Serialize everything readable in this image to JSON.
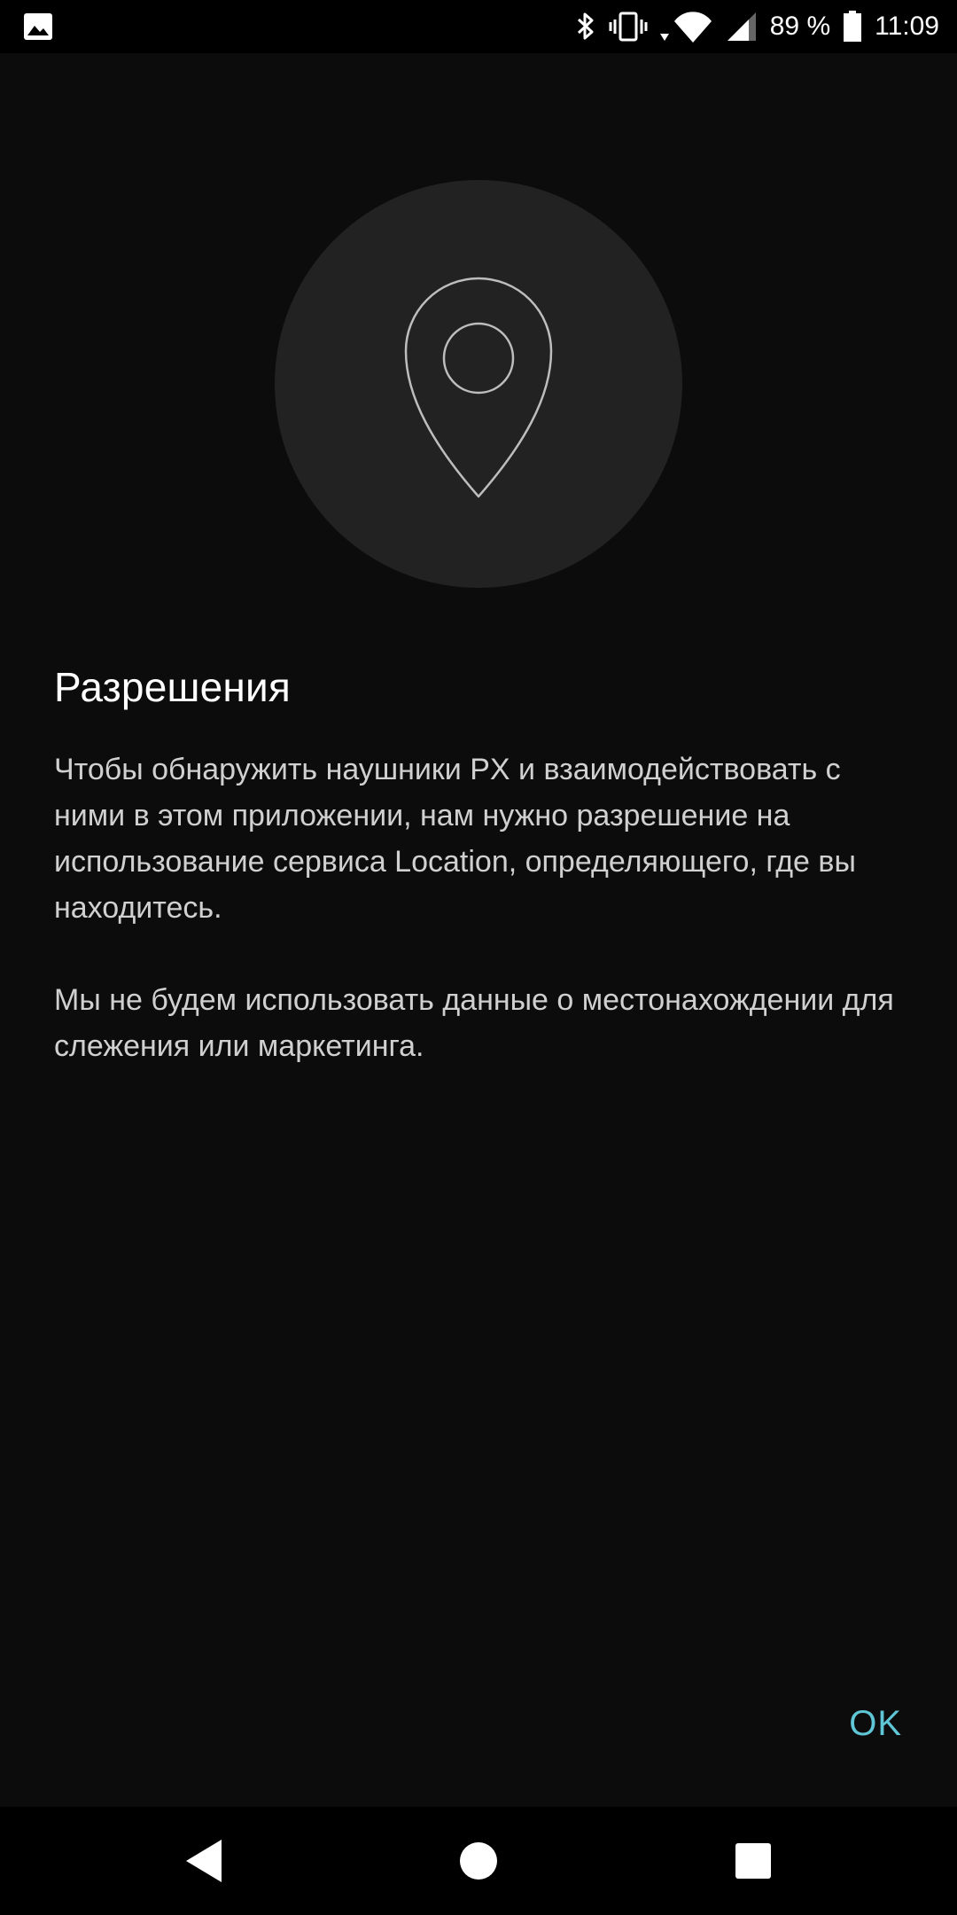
{
  "status_bar": {
    "battery_percent": "89 %",
    "time": "11:09",
    "icons": [
      "image-icon",
      "bluetooth-icon",
      "vibrate-icon",
      "wifi-icon",
      "cell-signal-icon",
      "battery-icon"
    ]
  },
  "dialog": {
    "hero_icon": "location-pin-icon",
    "title": "Разрешения",
    "paragraph_1": "Чтобы обнаружить наушники PX и взаимодействовать с ними в этом приложении, нам нужно разрешение на использование сервиса Location, определяющего, где вы находитесь.",
    "paragraph_2": "Мы не будем использовать данные о местонахождении для слежения или маркетинга.",
    "ok_label": "OK"
  },
  "nav_bar": {
    "icons": [
      "back-icon",
      "home-icon",
      "recents-icon"
    ]
  },
  "colors": {
    "background": "#0c0c0c",
    "hero_circle": "#222222",
    "accent": "#5fc6d6"
  }
}
